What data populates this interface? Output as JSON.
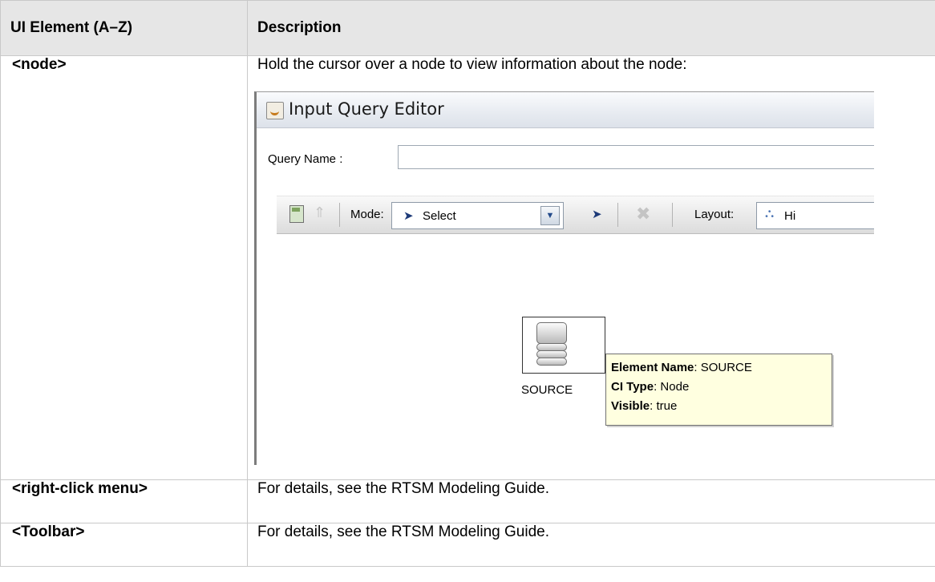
{
  "table": {
    "header": {
      "col1": "UI Element (A–Z)",
      "col2": "Description"
    },
    "rows": [
      {
        "name": "<node>",
        "description": "Hold the cursor over a node to view information about the node:"
      },
      {
        "name": "<right-click menu>",
        "description": "For details, see  the RTSM Modeling Guide."
      },
      {
        "name": "<Toolbar>",
        "description": "For details, see  the RTSM Modeling Guide."
      }
    ]
  },
  "screenshot": {
    "title": "Input Query Editor",
    "query_name_label": "Query Name :",
    "query_name_value": "",
    "toolbar": {
      "mode_label": "Mode:",
      "mode_value": "Select",
      "layout_label": "Layout:",
      "layout_value": "Hi"
    },
    "node": {
      "label": "SOURCE",
      "tooltip": {
        "element_name_label": "Element Name",
        "element_name_value": "SOURCE",
        "ci_type_label": "CI Type",
        "ci_type_value": "Node",
        "visible_label": "Visible",
        "visible_value": "true"
      }
    },
    "icons": [
      "java-app-icon",
      "calculator-icon",
      "move-up-icon",
      "pointer-icon",
      "dropdown-arrow-icon",
      "delete-icon",
      "hierarchy-layout-icon",
      "database-node-icon"
    ]
  }
}
